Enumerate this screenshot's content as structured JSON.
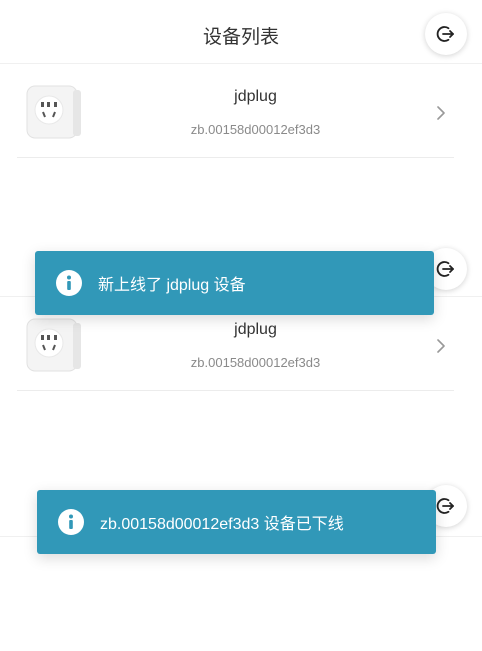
{
  "header": {
    "title": "设备列表"
  },
  "device": {
    "name": "jdplug",
    "id": "zb.00158d00012ef3d3"
  },
  "toasts": [
    {
      "message": "新上线了 jdplug 设备"
    },
    {
      "message": "zb.00158d00012ef3d3 设备已下线"
    }
  ],
  "icons": {
    "logout": "logout-icon",
    "info": "info-icon",
    "chevron": "chevron-right-icon",
    "device": "smart-plug-icon"
  },
  "colors": {
    "toast_bg": "#3198b8",
    "divider": "#ececec"
  }
}
